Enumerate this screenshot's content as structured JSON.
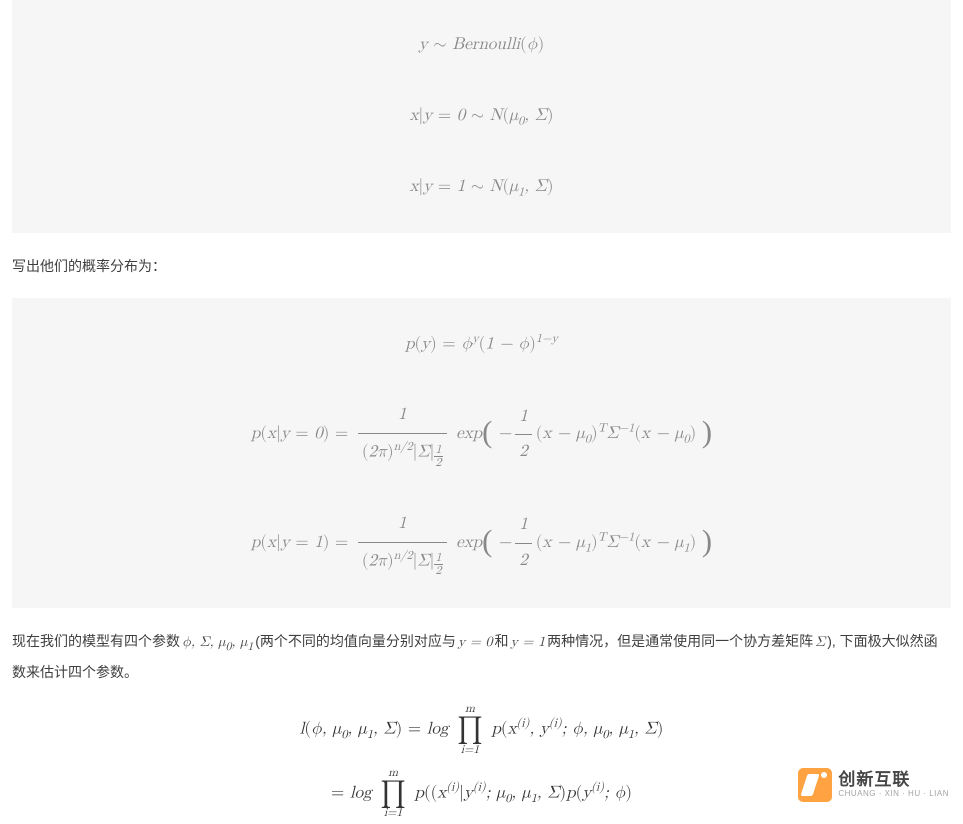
{
  "equations_block1": {
    "eq1": "y ∼ Bernoulli(ϕ)",
    "eq2": "x|y = 0 ∼ N(μ₀, Σ)",
    "eq3": "x|y = 1 ∼ N(μ₁, Σ)"
  },
  "paragraph1": "写出他们的概率分布为：",
  "equations_block2": {
    "eq1": "p(y) = ϕʸ(1 − ϕ)¹⁻ʸ",
    "eq2": "p(x|y = 0) = 1/((2π)^{n/2}|Σ|^{1/2}) · exp(−½(x − μ₀)ᵀΣ⁻¹(x − μ₀))",
    "eq3": "p(x|y = 1) = 1/((2π)^{n/2}|Σ|^{1/2}) · exp(−½(x − μ₁)ᵀΣ⁻¹(x − μ₁))"
  },
  "paragraph2": {
    "pre": "现在我们的模型有四个参数",
    "params": "ϕ, Σ, μ₀, μ₁",
    "mid1": "(两个不同的均值向量分别对应与",
    "y0": "y = 0",
    "mid2": "和",
    "y1": "y = 1",
    "mid3": "两种情况，但是通常使用同一个协方差矩阵",
    "sigma": "Σ",
    "suffix": "), 下面极大似然函数来估计四个参数。"
  },
  "equations_final": {
    "line1": "l(ϕ, μ₀, μ₁, Σ) = log ∏_{i=1}^{m} p(x^(i), y^(i); ϕ, μ₀, μ₁, Σ)",
    "line2": "= log ∏_{i=1}^{m} p((x^(i)|y^(i); μ₀, μ₁, Σ) p(y^(i); ϕ)"
  },
  "watermark": {
    "cn": "创新互联",
    "en": "CHUANG · XIN · HU · LIAN"
  }
}
